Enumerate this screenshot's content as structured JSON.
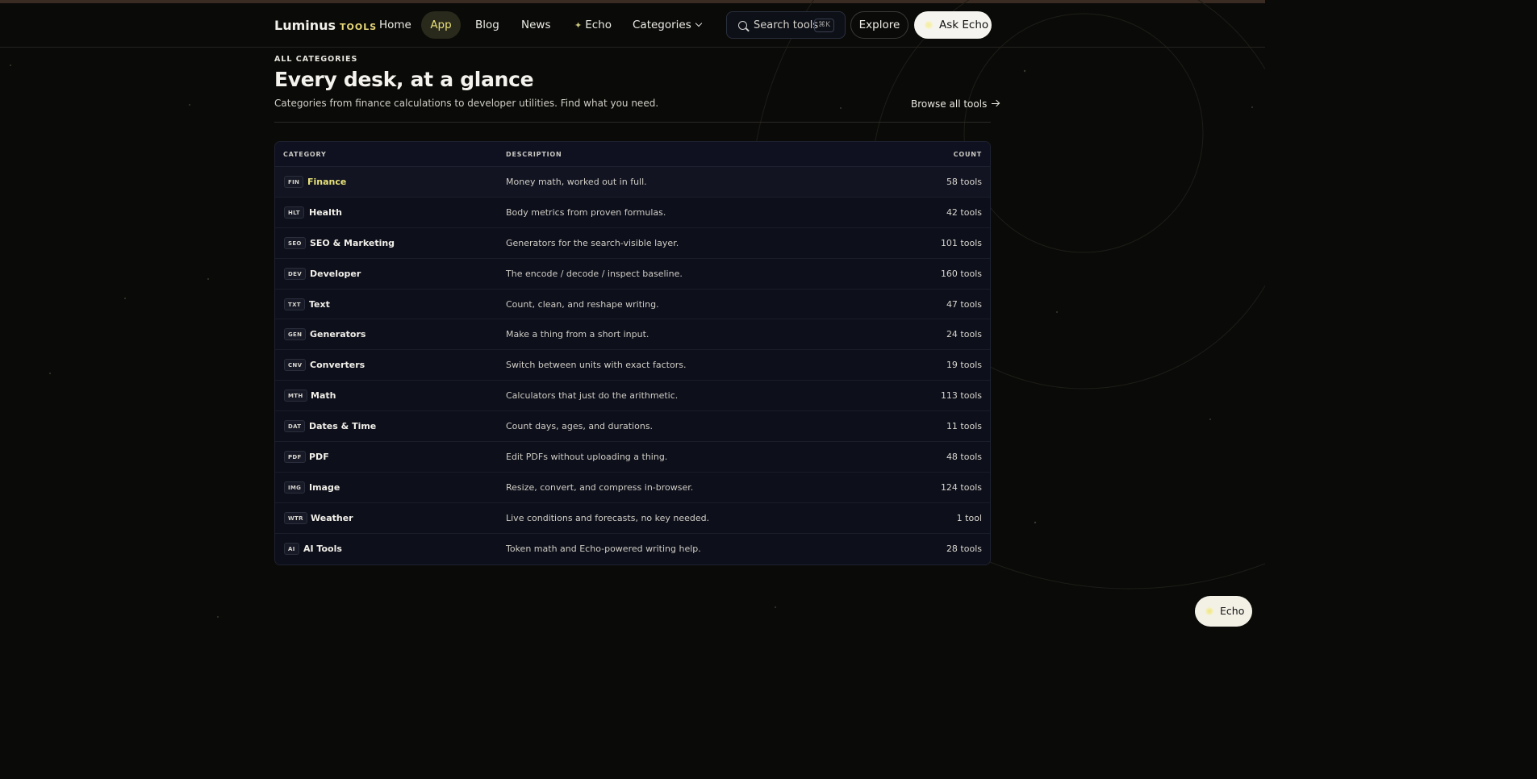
{
  "brand": {
    "name": "Luminus",
    "tag": "TOOLS"
  },
  "nav": {
    "home": "Home",
    "app": "App",
    "blog": "Blog",
    "news": "News",
    "echo": "Echo",
    "categories": "Categories"
  },
  "search": {
    "placeholder": "Search tools",
    "shortcut": "⌘K"
  },
  "actions": {
    "explore": "Explore",
    "ask_echo": "Ask Echo"
  },
  "section": {
    "eyebrow": "ALL CATEGORIES",
    "title": "Every desk, at a glance",
    "subtitle": "Categories from finance calculations to developer utilities. Find what you need.",
    "browse_link": "Browse all tools"
  },
  "table": {
    "headers": {
      "category": "CATEGORY",
      "description": "DESCRIPTION",
      "count": "COUNT"
    },
    "rows": [
      {
        "code": "FIN",
        "name": "Finance",
        "description": "Money math, worked out in full.",
        "count": "58 tools"
      },
      {
        "code": "HLT",
        "name": "Health",
        "description": "Body metrics from proven formulas.",
        "count": "42 tools"
      },
      {
        "code": "SEO",
        "name": "SEO & Marketing",
        "description": "Generators for the search-visible layer.",
        "count": "101 tools"
      },
      {
        "code": "DEV",
        "name": "Developer",
        "description": "The encode / decode / inspect baseline.",
        "count": "160 tools"
      },
      {
        "code": "TXT",
        "name": "Text",
        "description": "Count, clean, and reshape writing.",
        "count": "47 tools"
      },
      {
        "code": "GEN",
        "name": "Generators",
        "description": "Make a thing from a short input.",
        "count": "24 tools"
      },
      {
        "code": "CNV",
        "name": "Converters",
        "description": "Switch between units with exact factors.",
        "count": "19 tools"
      },
      {
        "code": "MTH",
        "name": "Math",
        "description": "Calculators that just do the arithmetic.",
        "count": "113 tools"
      },
      {
        "code": "DAT",
        "name": "Dates & Time",
        "description": "Count days, ages, and durations.",
        "count": "11 tools"
      },
      {
        "code": "PDF",
        "name": "PDF",
        "description": "Edit PDFs without uploading a thing.",
        "count": "48 tools"
      },
      {
        "code": "IMG",
        "name": "Image",
        "description": "Resize, convert, and compress in-browser.",
        "count": "124 tools"
      },
      {
        "code": "WTR",
        "name": "Weather",
        "description": "Live conditions and forecasts, no key needed.",
        "count": "1 tool"
      },
      {
        "code": "AI",
        "name": "AI Tools",
        "description": "Token math and Echo-powered writing help.",
        "count": "28 tools"
      }
    ]
  },
  "floating": {
    "echo": "Echo"
  },
  "colors": {
    "background": "#0a0a08",
    "accent_yellow": "#e9e37a",
    "table_bg": "#0d0f1a",
    "button_light": "#f5f4ef"
  }
}
